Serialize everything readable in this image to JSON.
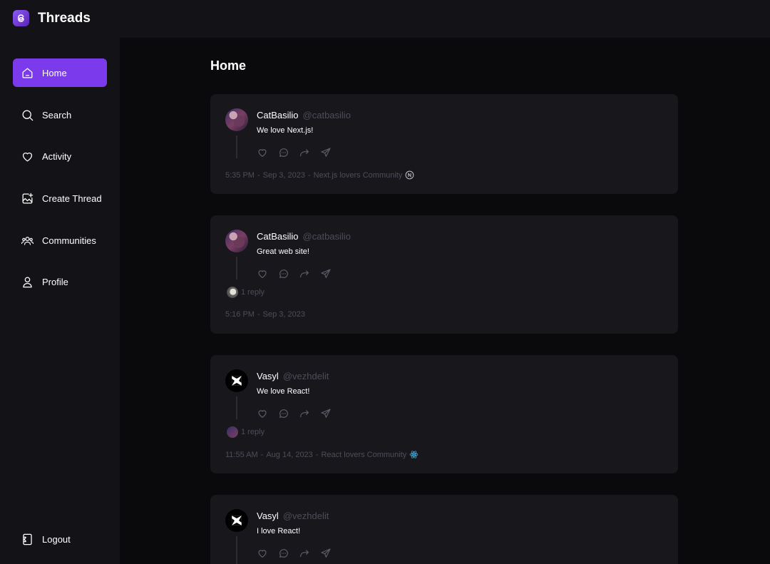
{
  "app": {
    "title": "Threads"
  },
  "nav": {
    "home": "Home",
    "search": "Search",
    "activity": "Activity",
    "create": "Create Thread",
    "communities": "Communities",
    "profile": "Profile",
    "logout": "Logout"
  },
  "page": {
    "title": "Home"
  },
  "threads": [
    {
      "author": "CatBasilio",
      "handle": "@catbasilio",
      "text": "We love Next.js!",
      "time": "5:35 PM",
      "date": "Sep 3, 2023",
      "community": "Next.js lovers Community",
      "community_icon": "nextjs-icon",
      "replies": ""
    },
    {
      "author": "CatBasilio",
      "handle": "@catbasilio",
      "text": "Great web site!",
      "time": "5:16 PM",
      "date": "Sep 3, 2023",
      "community": "",
      "replies": "1 reply"
    },
    {
      "author": "Vasyl",
      "handle": "@vezhdelit",
      "text": "We love React!",
      "time": "11:55 AM",
      "date": "Aug 14, 2023",
      "community": "React lovers Community",
      "community_icon": "react-icon",
      "replies": "1 reply"
    },
    {
      "author": "Vasyl",
      "handle": "@vezhdelit",
      "text": "I love React!",
      "time": "",
      "date": "",
      "community": "",
      "replies": ""
    }
  ],
  "separator": "-",
  "colors": {
    "accent": "#7c3aed",
    "surface": "#18181c",
    "sidebar": "#131317",
    "background": "#0a0a0c",
    "muted_text": "#4d4d5a"
  }
}
